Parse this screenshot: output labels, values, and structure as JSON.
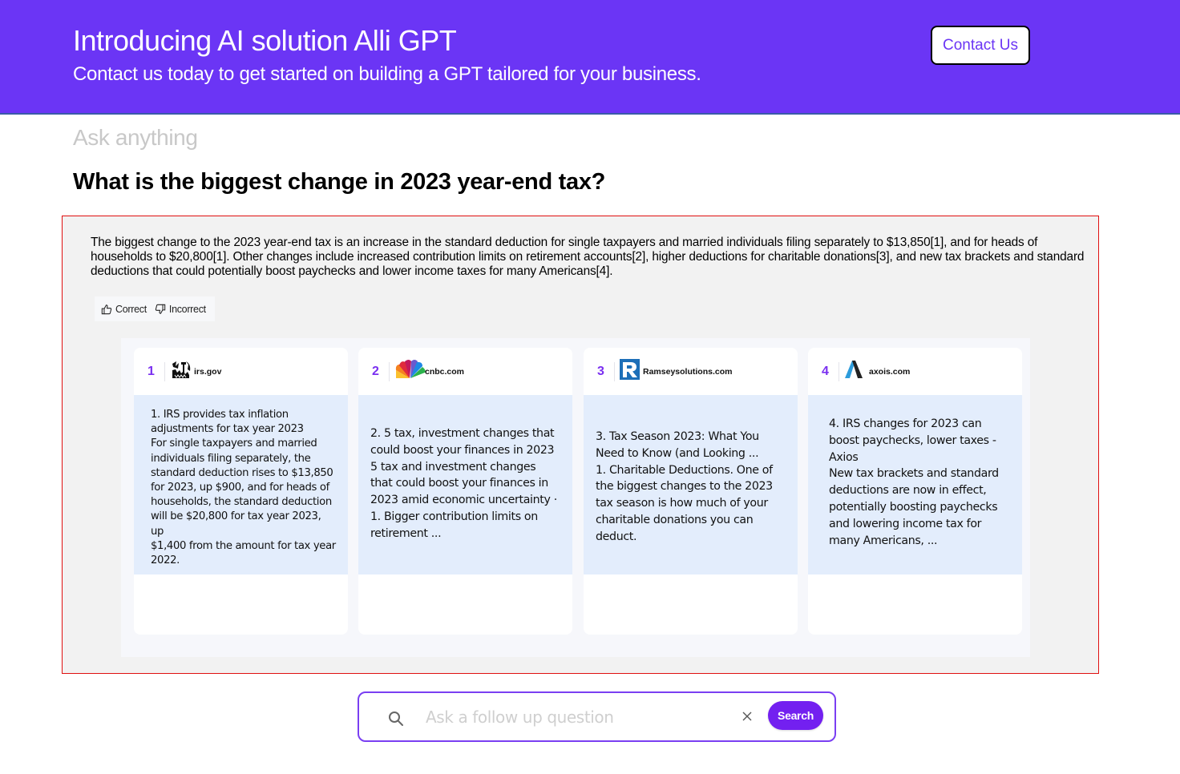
{
  "banner": {
    "title": "Introducing AI solution Alli GPT",
    "subtitle": "Contact us today to get started on building a GPT tailored for your business.",
    "contact_button": "Contact Us",
    "background_color": "#6b35f5"
  },
  "ask_label": "Ask anything",
  "question": "What is the biggest change in 2023 year-end tax?",
  "answer": {
    "text": "The biggest change to the 2023 year-end tax is an increase in the standard deduction for single taxpayers and married individuals filing separately to $13,850[1], and for heads of households to $20,800[1]. Other changes include increased contribution limits on retirement accounts[2], higher deductions for charitable donations[3], and new tax brackets and standard deductions that could potentially boost paychecks and lower income taxes for many Americans[4].",
    "feedback": {
      "correct_label": "Correct",
      "incorrect_label": "Incorrect",
      "correct_icon": "thumbs-up-icon",
      "incorrect_icon": "thumbs-down-icon"
    }
  },
  "sources": [
    {
      "number": "1",
      "domain": "irs.gov",
      "logo": "irs-eagle-logo",
      "snippet": "1. IRS provides tax inflation\nadjustments for tax year 2023\nFor single taxpayers and married\nindividuals filing separately, the\nstandard deduction rises to $13,850\nfor 2023, up $900, and for heads of\nhouseholds, the standard deduction\nwill be $20,800 for tax year 2023, up\n$1,400 from the amount for tax year\n2022."
    },
    {
      "number": "2",
      "domain": "cnbc.com",
      "logo": "cnbc-peacock-logo",
      "snippet": "2. 5 tax, investment changes that\ncould boost your finances in 2023\n5 tax and investment changes\nthat could boost your finances in\n2023 amid economic uncertainty ·\n1. Bigger contribution limits on\nretirement ..."
    },
    {
      "number": "3",
      "domain": "Ramseysolutions.com",
      "logo": "ramsey-r-logo",
      "snippet": "3. Tax Season 2023: What You\nNeed to Know (and Looking ...\n1. Charitable Deductions. One of\nthe biggest changes to the 2023\ntax season is how much of your\ncharitable donations you can\ndeduct."
    },
    {
      "number": "4",
      "domain": "axois.com",
      "logo": "axios-logo",
      "snippet": "4. IRS changes for 2023 can\nboost paychecks, lower taxes -\nAxios\nNew tax brackets and standard\ndeductions are now in effect,\npotentially boosting paychecks\nand lowering income tax for\nmany Americans, ..."
    }
  ],
  "followup": {
    "placeholder": "Ask a follow up question",
    "value": "",
    "search_button": "Search",
    "clear_icon": "close-icon",
    "search_icon": "search-icon",
    "accent_color": "#7320f0"
  }
}
